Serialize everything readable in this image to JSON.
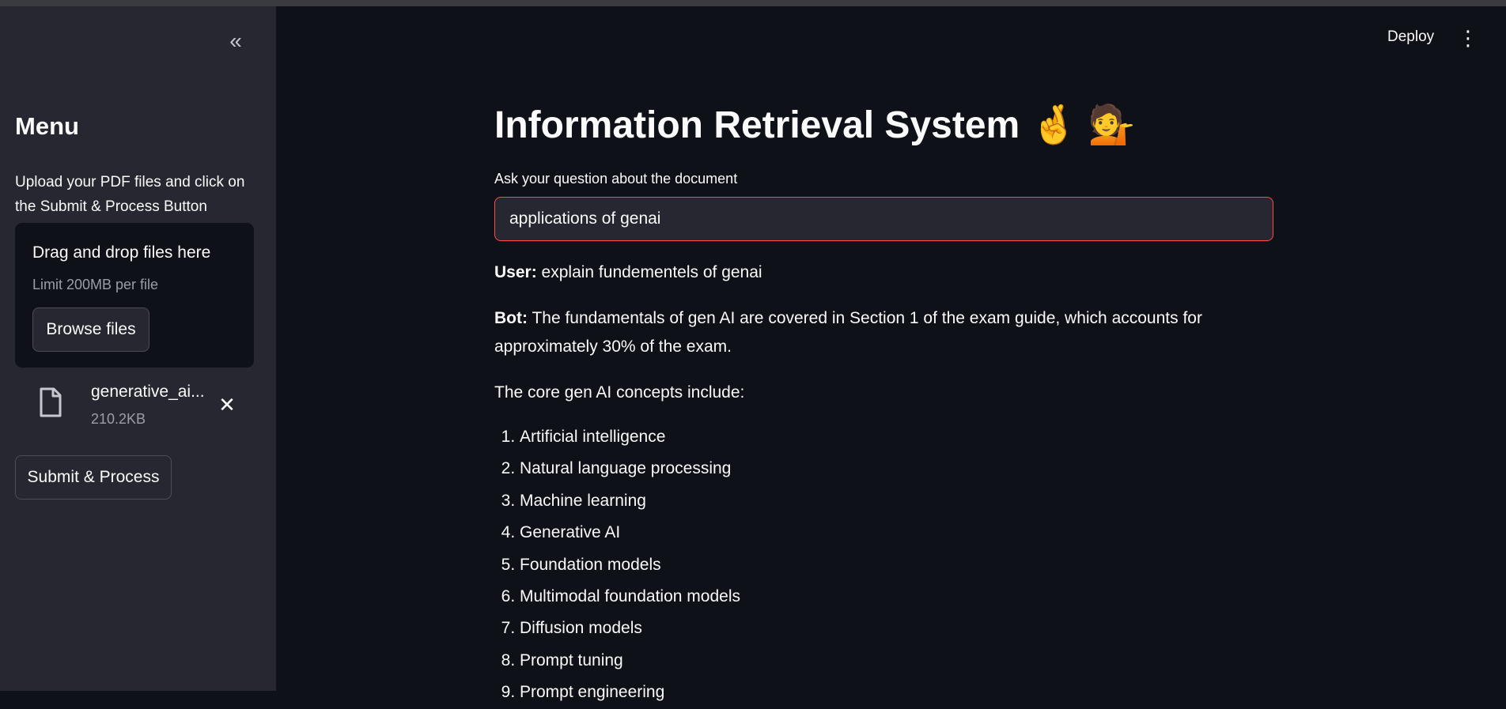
{
  "sidebar": {
    "collapse_icon": "«",
    "menu_title": "Menu",
    "upload_description": "Upload your PDF files and click on the Submit & Process Button",
    "dropzone": {
      "title": "Drag and drop files here",
      "limit": "Limit 200MB per file",
      "browse_label": "Browse files"
    },
    "file": {
      "name": "generative_ai...",
      "size": "210.2KB",
      "icon": "file-icon",
      "remove_icon": "close-icon"
    },
    "submit_label": "Submit & Process"
  },
  "header": {
    "deploy_label": "Deploy",
    "menu_icon": "⋮"
  },
  "main": {
    "title": "Information Retrieval System 🤞 💁",
    "question_label": "Ask your question about the document",
    "question_value": "applications of genai",
    "chat": {
      "user_prefix": "User:",
      "user_message": "explain fundementels of genai",
      "bot_prefix": "Bot:",
      "bot_message": "The fundamentals of gen AI are covered in Section 1 of the exam guide, which accounts for approximately 30% of the exam.",
      "list_intro": "The core gen AI concepts include:",
      "concepts": [
        "Artificial intelligence",
        "Natural language processing",
        "Machine learning",
        "Generative AI",
        "Foundation models",
        "Multimodal foundation models",
        "Diffusion models",
        "Prompt tuning",
        "Prompt engineering"
      ]
    }
  },
  "colors": {
    "background": "#0e1117",
    "sidebar": "#262730",
    "accent_border": "#ff4b4b"
  }
}
